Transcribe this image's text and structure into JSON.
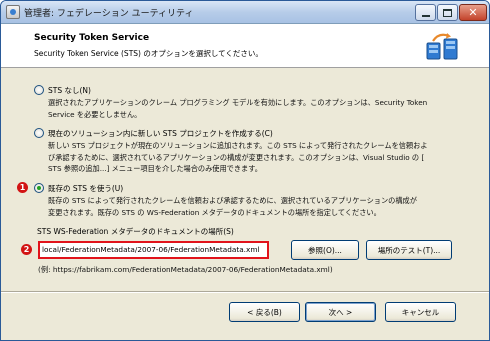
{
  "window": {
    "title": "管理者: フェデレーション ユーティリティ"
  },
  "header": {
    "title": "Security Token Service",
    "subtitle": "Security Token Service (STS) のオプションを選択してください。"
  },
  "options": [
    {
      "label": "STS なし(N)",
      "desc": [
        "選択されたアプリケーションのクレーム プログラミング モデルを有効にします。このオプションは、Security Token",
        "Service を必要としません。"
      ],
      "selected": false
    },
    {
      "label": "現在のソリューション内に新しい STS プロジェクトを作成する(C)",
      "desc": [
        "新しい STS プロジェクトが現在のソリューションに追加されます。この STS によって発行されたクレームを信頼およ",
        "び承認するために、選択されているアプリケーションの構成が変更されます。このオプションは、Visual Studio の [",
        "STS 参照の追加...] メニュー項目を介した場合のみ使用できます。"
      ],
      "selected": false
    },
    {
      "label": "既存の STS を使う(U)",
      "desc": [
        "既存の STS によって発行されたクレームを信頼および承認するために、選択されているアプリケーションの構成が",
        "変更されます。既存の STS の WS-Federation メタデータのドキュメントの場所を指定してください。"
      ],
      "selected": true
    }
  ],
  "metadata": {
    "label": "STS WS-Federation メタデータのドキュメントの場所(S)",
    "value": "local/FederationMetadata/2007-06/FederationMetadata.xml",
    "example": "(例: https://fabrikam.com/FederationMetadata/2007-06/FederationMetadata.xml)",
    "browse_label": "参照(O)...",
    "test_label": "場所のテスト(T)..."
  },
  "badges": [
    "1",
    "2"
  ],
  "footer": {
    "back_label": "< 戻る(B)",
    "next_label": "次へ >",
    "cancel_label": "キャンセル"
  },
  "colors": {
    "selected_radio": "#22a022",
    "callout_red": "#d21414",
    "titlebar": "#b7cde9"
  }
}
